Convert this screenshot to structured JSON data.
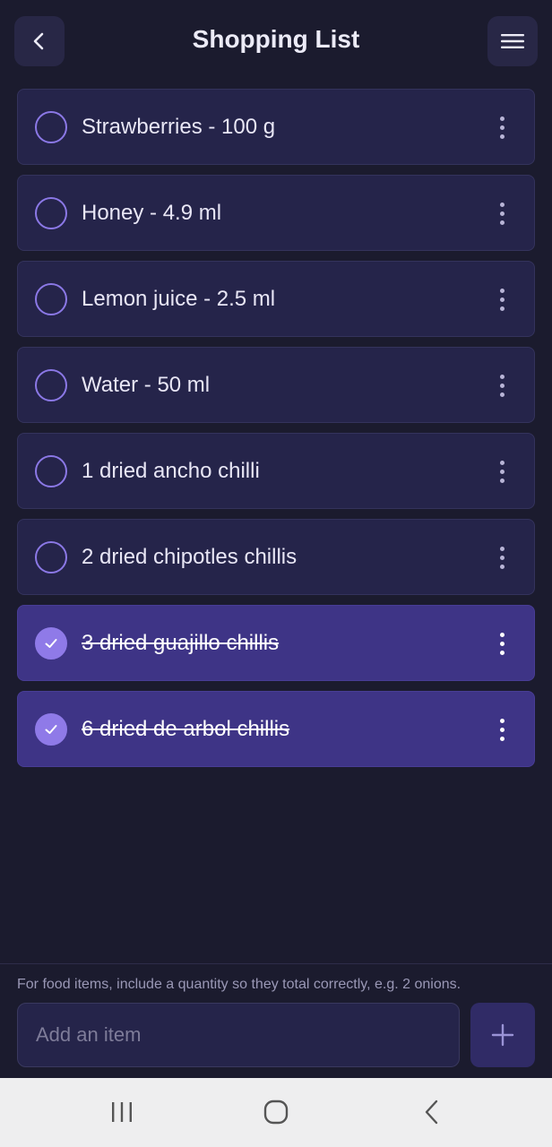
{
  "header": {
    "title": "Shopping List",
    "back_icon": "chevron-left-icon",
    "menu_icon": "hamburger-menu-icon"
  },
  "items": [
    {
      "label": "Strawberries - 100 g",
      "checked": false
    },
    {
      "label": "Honey - 4.9 ml",
      "checked": false
    },
    {
      "label": "Lemon juice - 2.5 ml",
      "checked": false
    },
    {
      "label": "Water - 50 ml",
      "checked": false
    },
    {
      "label": "1 dried ancho chilli",
      "checked": false
    },
    {
      "label": "2 dried chipotles chillis",
      "checked": false
    },
    {
      "label": "3 dried guajillo chillis",
      "checked": true
    },
    {
      "label": "6 dried de arbol chillis",
      "checked": true
    }
  ],
  "footer": {
    "hint": "For food items, include a quantity so they total correctly, e.g. 2 onions.",
    "input_placeholder": "Add an item",
    "input_value": "",
    "add_icon": "plus-icon"
  },
  "system_nav": {
    "recents_icon": "recents-icon",
    "home_icon": "home-icon",
    "back_icon": "back-icon"
  },
  "colors": {
    "background": "#1b1b2e",
    "item_background": "#25244a",
    "item_checked_background": "#3e3486",
    "accent": "#8f7ae8",
    "nav_bar": "#eeeeef"
  }
}
